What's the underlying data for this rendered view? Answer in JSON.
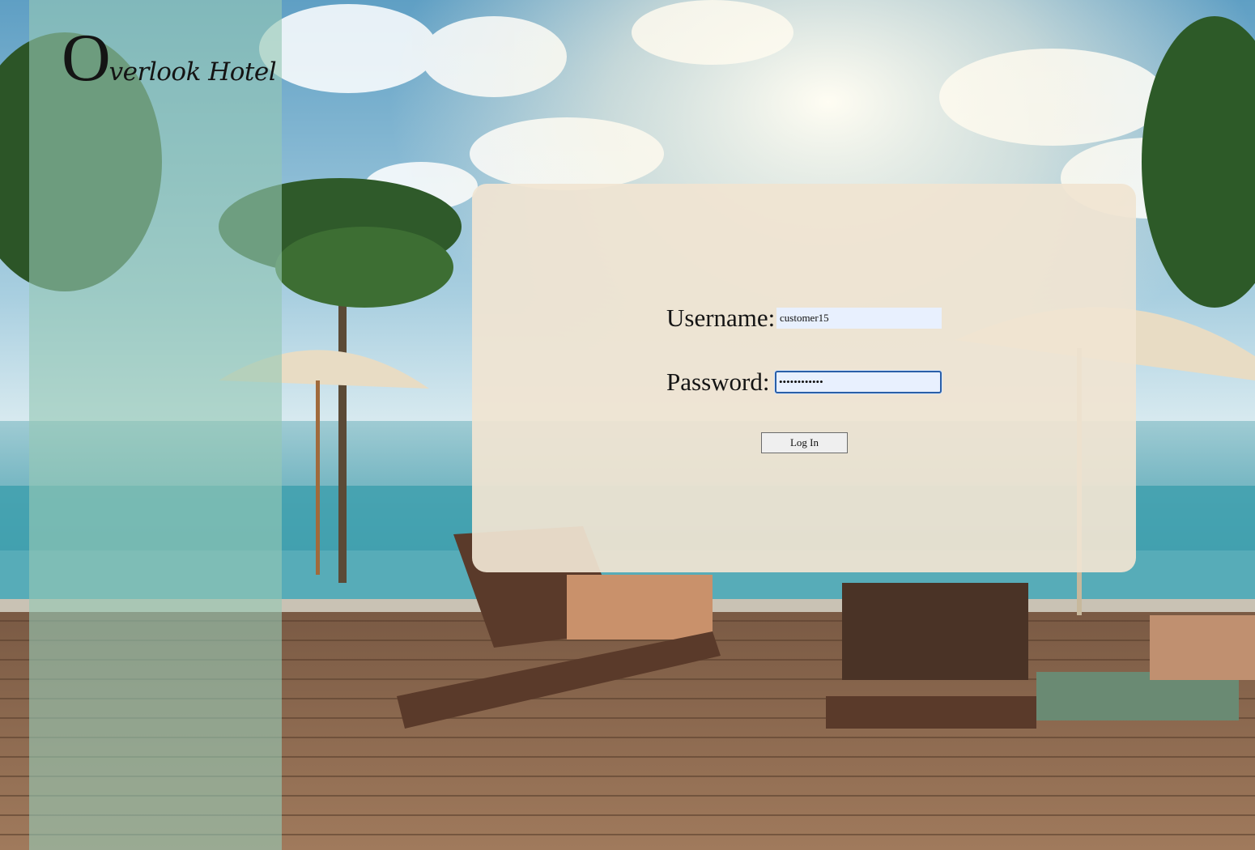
{
  "sidebar": {
    "logo": {
      "initial": "O",
      "rest": "verlook Hotel"
    }
  },
  "login": {
    "username_label": "Username:",
    "username_value": "customer15",
    "password_label": "Password:",
    "password_value": "customer1500",
    "submit_label": "Log In"
  }
}
